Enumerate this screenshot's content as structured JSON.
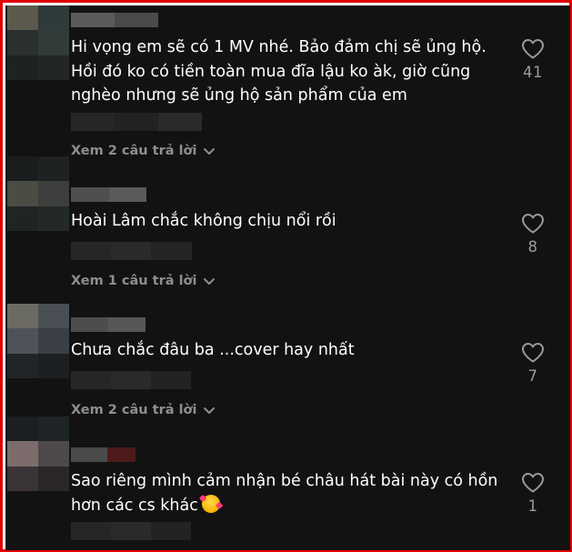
{
  "comments": [
    {
      "text": "Hi vọng em sẽ có 1 MV nhé. Bảo đảm chị sẽ ủng hộ.\nHồi đó ko có tiền toàn mua đĩa lậu ko àk, giờ cũng\nnghèo nhưng sẽ ủng hộ sản phẩm của em",
      "likes": "41",
      "replies": "Xem 2 câu trả lời"
    },
    {
      "text": "Hoài Lâm chắc không chịu nổi rồi",
      "likes": "8",
      "replies": "Xem 1 câu trả lời"
    },
    {
      "text": "Chưa chắc đâu ba ...cover hay nhất",
      "likes": "7",
      "replies": "Xem 2 câu trả lời"
    },
    {
      "text": "Sao riêng mình cảm nhận bé châu hát bài này có hồn\nhơn các cs khác",
      "likes": "1"
    }
  ],
  "icons": {
    "like": "heart-outline-icon",
    "expand": "chevron-down-icon",
    "emoji": "smiling-face-with-hearts-emoji"
  },
  "colors": {
    "background": "#121212",
    "text": "#ffffff",
    "muted": "#8e8e8e",
    "frame": "#e00000"
  }
}
